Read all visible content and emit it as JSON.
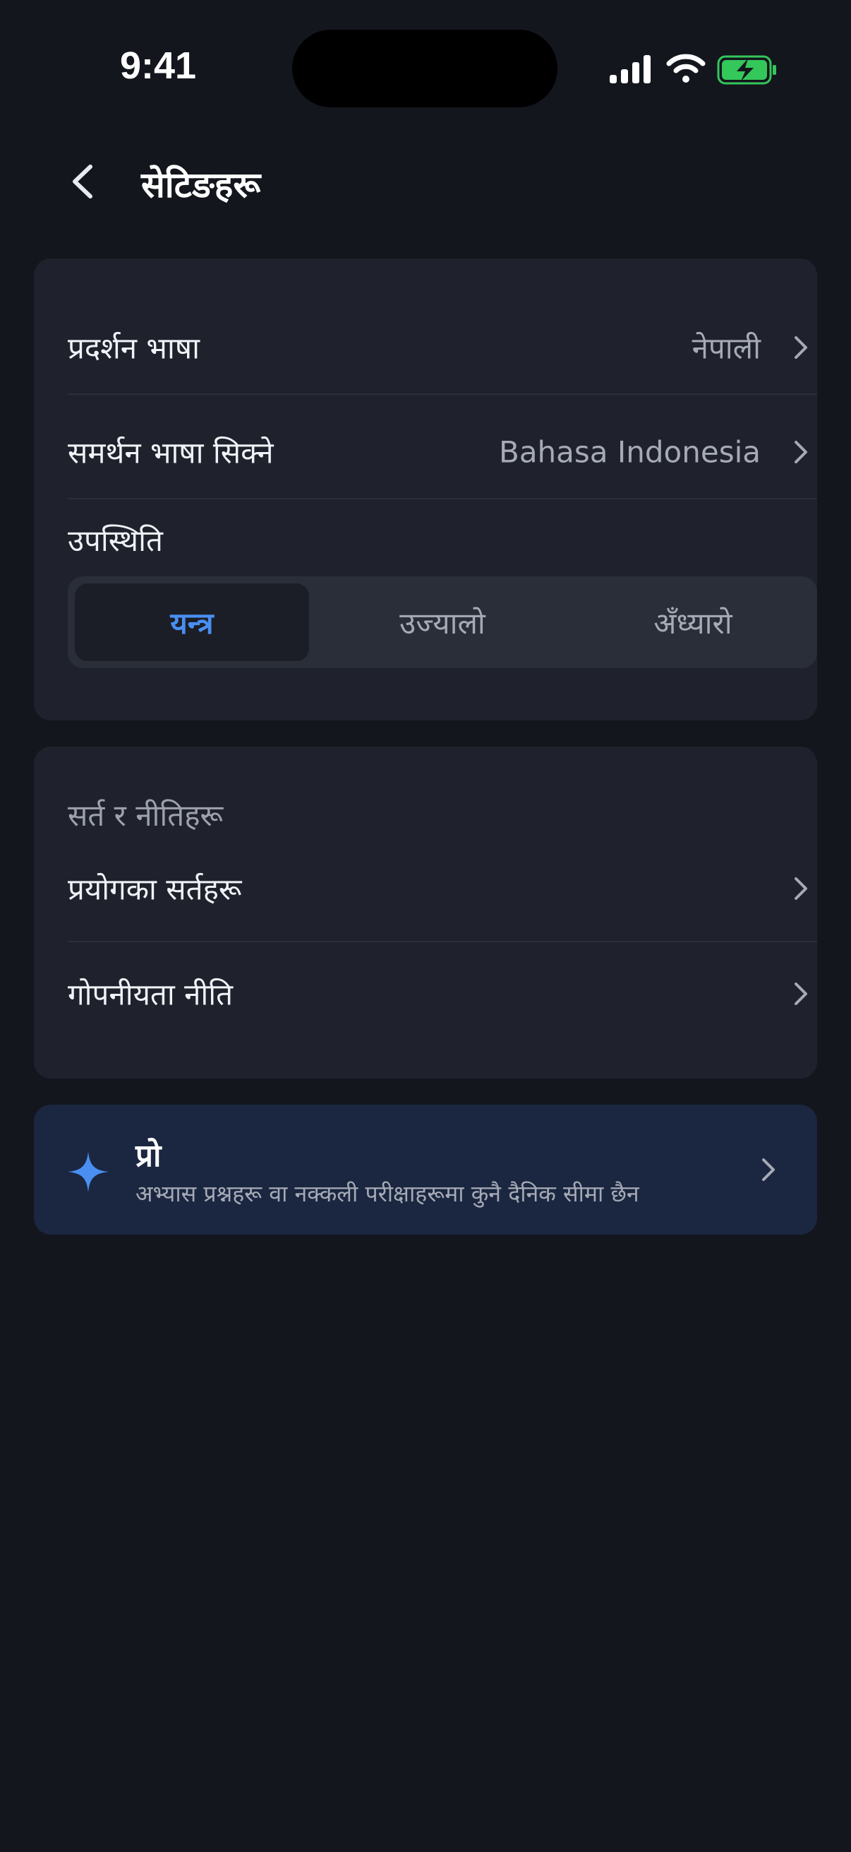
{
  "status_bar": {
    "time": "9:41"
  },
  "header": {
    "title": "सेटिङहरू",
    "back_icon": "chevron-left-icon"
  },
  "settings": {
    "display_language": {
      "label": "प्रदर्शन भाषा",
      "value": "नेपाली"
    },
    "support_language": {
      "label": "समर्थन भाषा सिक्ने",
      "value": "Bahasa Indonesia"
    },
    "appearance": {
      "label": "उपस्थिति",
      "options": [
        "यन्त्र",
        "उज्यालो",
        "अँध्यारो"
      ],
      "selected": "यन्त्र"
    }
  },
  "legal": {
    "section_label": "सर्त र नीतिहरू",
    "terms": "प्रयोगका सर्तहरू",
    "privacy": "गोपनीयता नीति"
  },
  "pro": {
    "title": "प्रो",
    "subtitle": "अभ्यास प्रश्नहरू वा नक्कली परीक्षाहरूमा कुनै दैनिक सीमा छैन",
    "icon": "sparkle-icon"
  },
  "colors": {
    "background": "#14161e",
    "card": "#1f222c",
    "pro_card": "#1b2740",
    "accent": "#4a8ef2",
    "battery_green": "#34c759"
  }
}
